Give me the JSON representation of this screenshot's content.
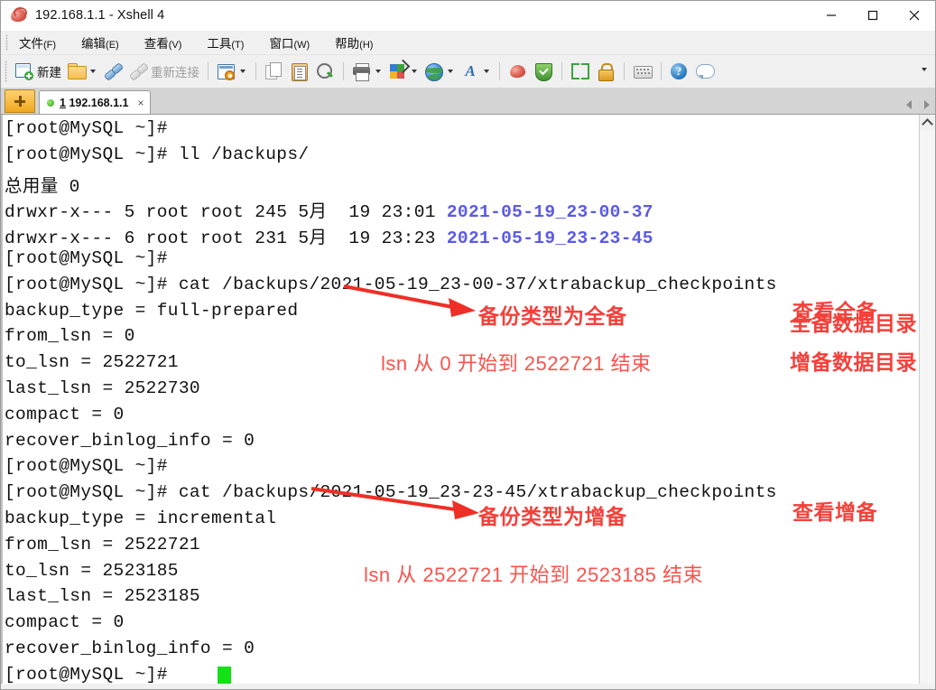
{
  "window": {
    "title": "192.168.1.1 - Xshell 4",
    "app_icon": "xshell-icon",
    "controls": {
      "minimize": "minimize",
      "maximize": "maximize",
      "close": "close"
    }
  },
  "menubar": {
    "items": [
      {
        "label": "文件",
        "mnemonic": "(F)"
      },
      {
        "label": "编辑",
        "mnemonic": "(E)"
      },
      {
        "label": "查看",
        "mnemonic": "(V)"
      },
      {
        "label": "工具",
        "mnemonic": "(T)"
      },
      {
        "label": "窗口",
        "mnemonic": "(W)"
      },
      {
        "label": "帮助",
        "mnemonic": "(H)"
      }
    ]
  },
  "toolbar": {
    "new_label": "新建",
    "reconnect_label": "重新连接",
    "items": [
      {
        "name": "new-session-button",
        "icon": "new-document-icon",
        "label": "新建"
      },
      {
        "name": "open-session-button",
        "icon": "folder-open-icon",
        "label": ""
      },
      {
        "name": "connect-button",
        "icon": "plug-connect-icon",
        "label": ""
      },
      {
        "name": "disconnect-button",
        "icon": "plug-disconnect-icon",
        "label": ""
      },
      {
        "name": "reconnect-button",
        "icon": "",
        "label": "重新连接"
      },
      {
        "name": "properties-button",
        "icon": "properties-icon",
        "label": ""
      },
      {
        "name": "copy-button",
        "icon": "copy-icon",
        "label": ""
      },
      {
        "name": "paste-button",
        "icon": "paste-icon",
        "label": ""
      },
      {
        "name": "find-button",
        "icon": "search-icon",
        "label": ""
      },
      {
        "name": "print-button",
        "icon": "print-icon",
        "label": ""
      },
      {
        "name": "color-scheme-button",
        "icon": "palette-icon",
        "label": ""
      },
      {
        "name": "web-button",
        "icon": "globe-icon",
        "label": ""
      },
      {
        "name": "font-button",
        "icon": "font-a-icon",
        "label": ""
      },
      {
        "name": "xshell-button",
        "icon": "xshell-icon",
        "label": ""
      },
      {
        "name": "xftp-button",
        "icon": "green-shield-icon",
        "label": ""
      },
      {
        "name": "fullscreen-button",
        "icon": "fullscreen-icon",
        "label": ""
      },
      {
        "name": "lock-button",
        "icon": "lock-icon",
        "label": ""
      },
      {
        "name": "keyboard-button",
        "icon": "keyboard-icon",
        "label": ""
      },
      {
        "name": "help-button",
        "icon": "help-icon",
        "label": "?"
      },
      {
        "name": "chat-button",
        "icon": "chat-icon",
        "label": ""
      }
    ]
  },
  "tabbar": {
    "new_tab_icon": "plus-icon",
    "tabs": [
      {
        "index": "1",
        "title": "192.168.1.1",
        "status": "connected",
        "close": "×"
      }
    ]
  },
  "terminal": {
    "prompt": "[root@MySQL ~]#",
    "cursor_color": "#15e015",
    "dir_color": "#5a5ae6",
    "lines": [
      {
        "text": "[root@MySQL ~]# "
      },
      {
        "text": "[root@MySQL ~]# ll /backups/"
      },
      {
        "text": "总用量 0"
      },
      {
        "text": "drwxr-x--- 5 root root 245 5月  19 23:01 ",
        "blue": "2021-05-19_23-00-37"
      },
      {
        "text": "drwxr-x--- 6 root root 231 5月  19 23:23 ",
        "blue": "2021-05-19_23-23-45"
      },
      {
        "text": "[root@MySQL ~]# "
      },
      {
        "text": "[root@MySQL ~]# cat /backups/2021-05-19_23-00-37/xtrabackup_checkpoints"
      },
      {
        "text": "backup_type = full-prepared"
      },
      {
        "text": "from_lsn = 0"
      },
      {
        "text": "to_lsn = 2522721"
      },
      {
        "text": "last_lsn = 2522730"
      },
      {
        "text": "compact = 0"
      },
      {
        "text": "recover_binlog_info = 0"
      },
      {
        "text": "[root@MySQL ~]# "
      },
      {
        "text": "[root@MySQL ~]# cat /backups/2021-05-19_23-23-45/xtrabackup_checkpoints"
      },
      {
        "text": "backup_type = incremental"
      },
      {
        "text": "from_lsn = 2522721"
      },
      {
        "text": "to_lsn = 2523185"
      },
      {
        "text": "last_lsn = 2523185"
      },
      {
        "text": "compact = 0"
      },
      {
        "text": "recover_binlog_info = 0"
      },
      {
        "text": "[root@MySQL ~]# "
      }
    ]
  },
  "annotations": {
    "color": "#f4362f",
    "items": [
      {
        "name": "annotation-full-backup-dir",
        "text": "全备数据目录"
      },
      {
        "name": "annotation-incr-backup-dir",
        "text": "增备数据目录"
      },
      {
        "name": "annotation-backup-type-full",
        "text": "备份类型为全备"
      },
      {
        "name": "annotation-view-full",
        "text": "查看全备"
      },
      {
        "name": "annotation-lsn-full",
        "text": "lsn 从 0 开始到 2522721 结束"
      },
      {
        "name": "annotation-backup-type-incr",
        "text": "备份类型为增备"
      },
      {
        "name": "annotation-view-incr",
        "text": "查看增备"
      },
      {
        "name": "annotation-lsn-incr",
        "text": "lsn 从 2522721 开始到 2523185 结束"
      }
    ]
  },
  "scrollbar": {
    "up_arrow": "chevron-up-icon"
  }
}
